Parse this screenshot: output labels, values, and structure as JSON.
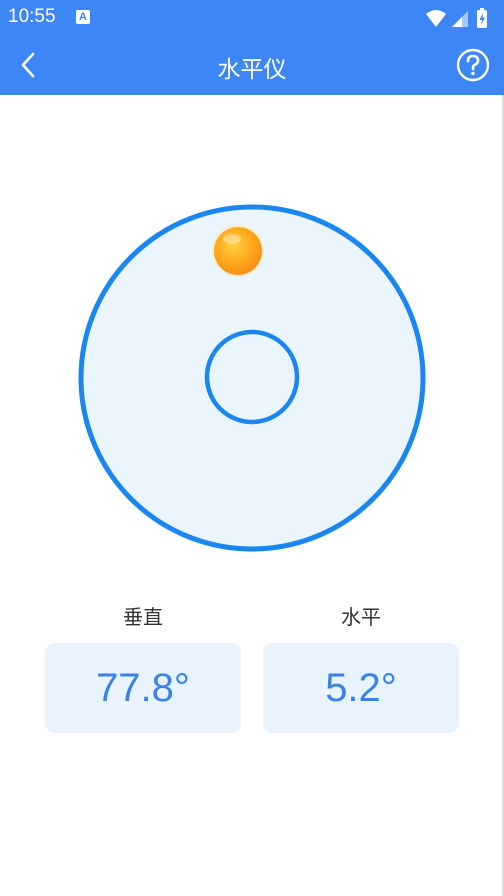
{
  "status_bar": {
    "time": "10:55",
    "icons": [
      "a-notification-icon",
      "wifi-icon",
      "signal-icon",
      "battery-icon"
    ]
  },
  "header": {
    "title": "水平仪",
    "back_icon": "chevron-left-icon",
    "help_icon": "question-circle-icon"
  },
  "colors": {
    "primary": "#3d86f6",
    "ring": "#1a86f0",
    "gauge_fill": "#eaf5fd",
    "bubble": "#ffa81a",
    "box_bg": "#e8f3fd",
    "value_text": "#3a82ea"
  },
  "readings": {
    "vertical": {
      "label": "垂直",
      "value": "77.8°"
    },
    "horizontal": {
      "label": "水平",
      "value": "5.2°"
    }
  }
}
